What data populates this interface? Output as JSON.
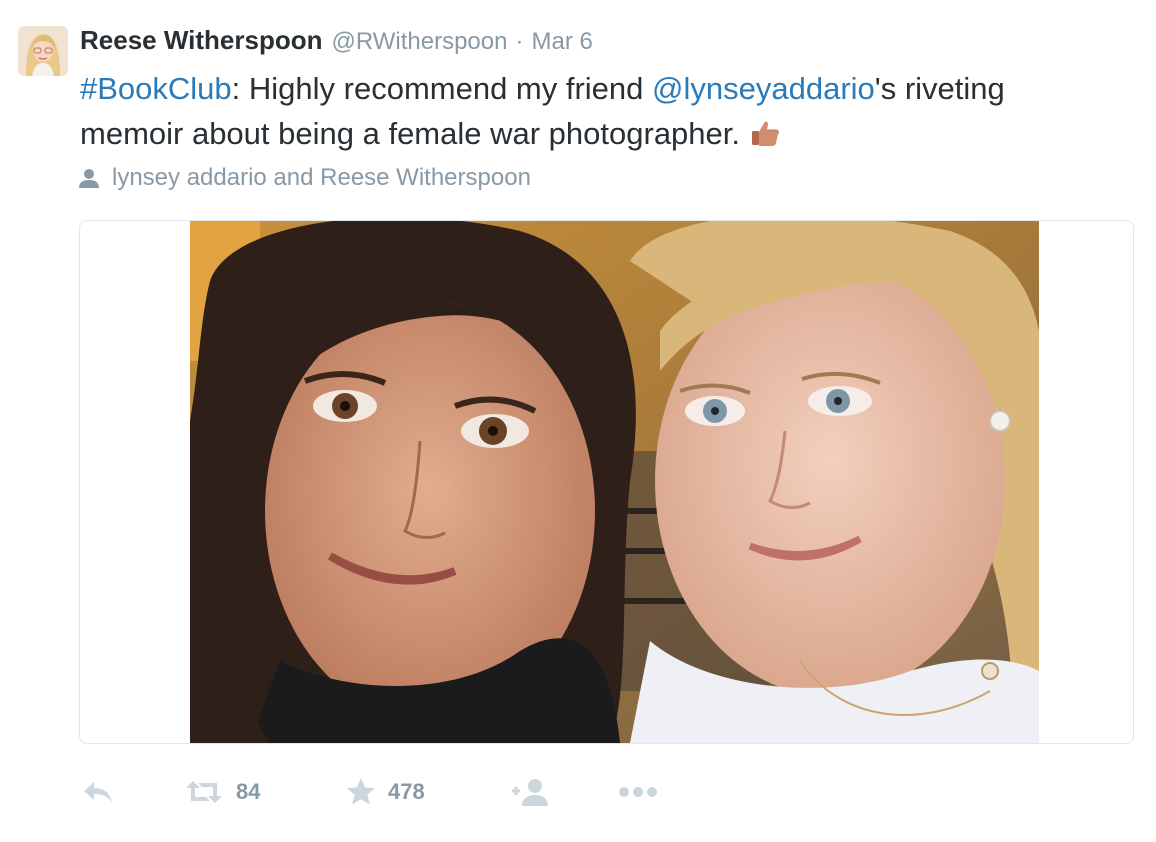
{
  "tweet": {
    "author": {
      "fullname": "Reese Witherspoon",
      "username": "@RWitherspoon",
      "avatar_icon": "profile-photo"
    },
    "separator": "·",
    "timestamp": "Mar 6",
    "text": {
      "hashtag": "#BookClub",
      "part1": ": Highly recommend my friend ",
      "mention": "@lynseyaddario",
      "part2": "'s riveting memoir about being a female war photographer.",
      "emoji": "thumbs-up-emoji"
    },
    "tagged": {
      "icon": "person-icon",
      "names": "lynsey addario and Reese Witherspoon"
    },
    "media": {
      "type": "photo",
      "subject": "selfie"
    },
    "actions": {
      "reply": {
        "icon": "reply-icon"
      },
      "retweet": {
        "icon": "retweet-icon",
        "count": "84"
      },
      "favorite": {
        "icon": "star-icon",
        "count": "478"
      },
      "follow": {
        "icon": "add-person-icon"
      },
      "more": {
        "icon": "more-dots-icon"
      }
    }
  },
  "colors": {
    "link": "#2b7bb9",
    "meta": "#8899a6",
    "text": "#292f33",
    "border": "#e1e8ed",
    "icon": "#ccd6dd"
  }
}
